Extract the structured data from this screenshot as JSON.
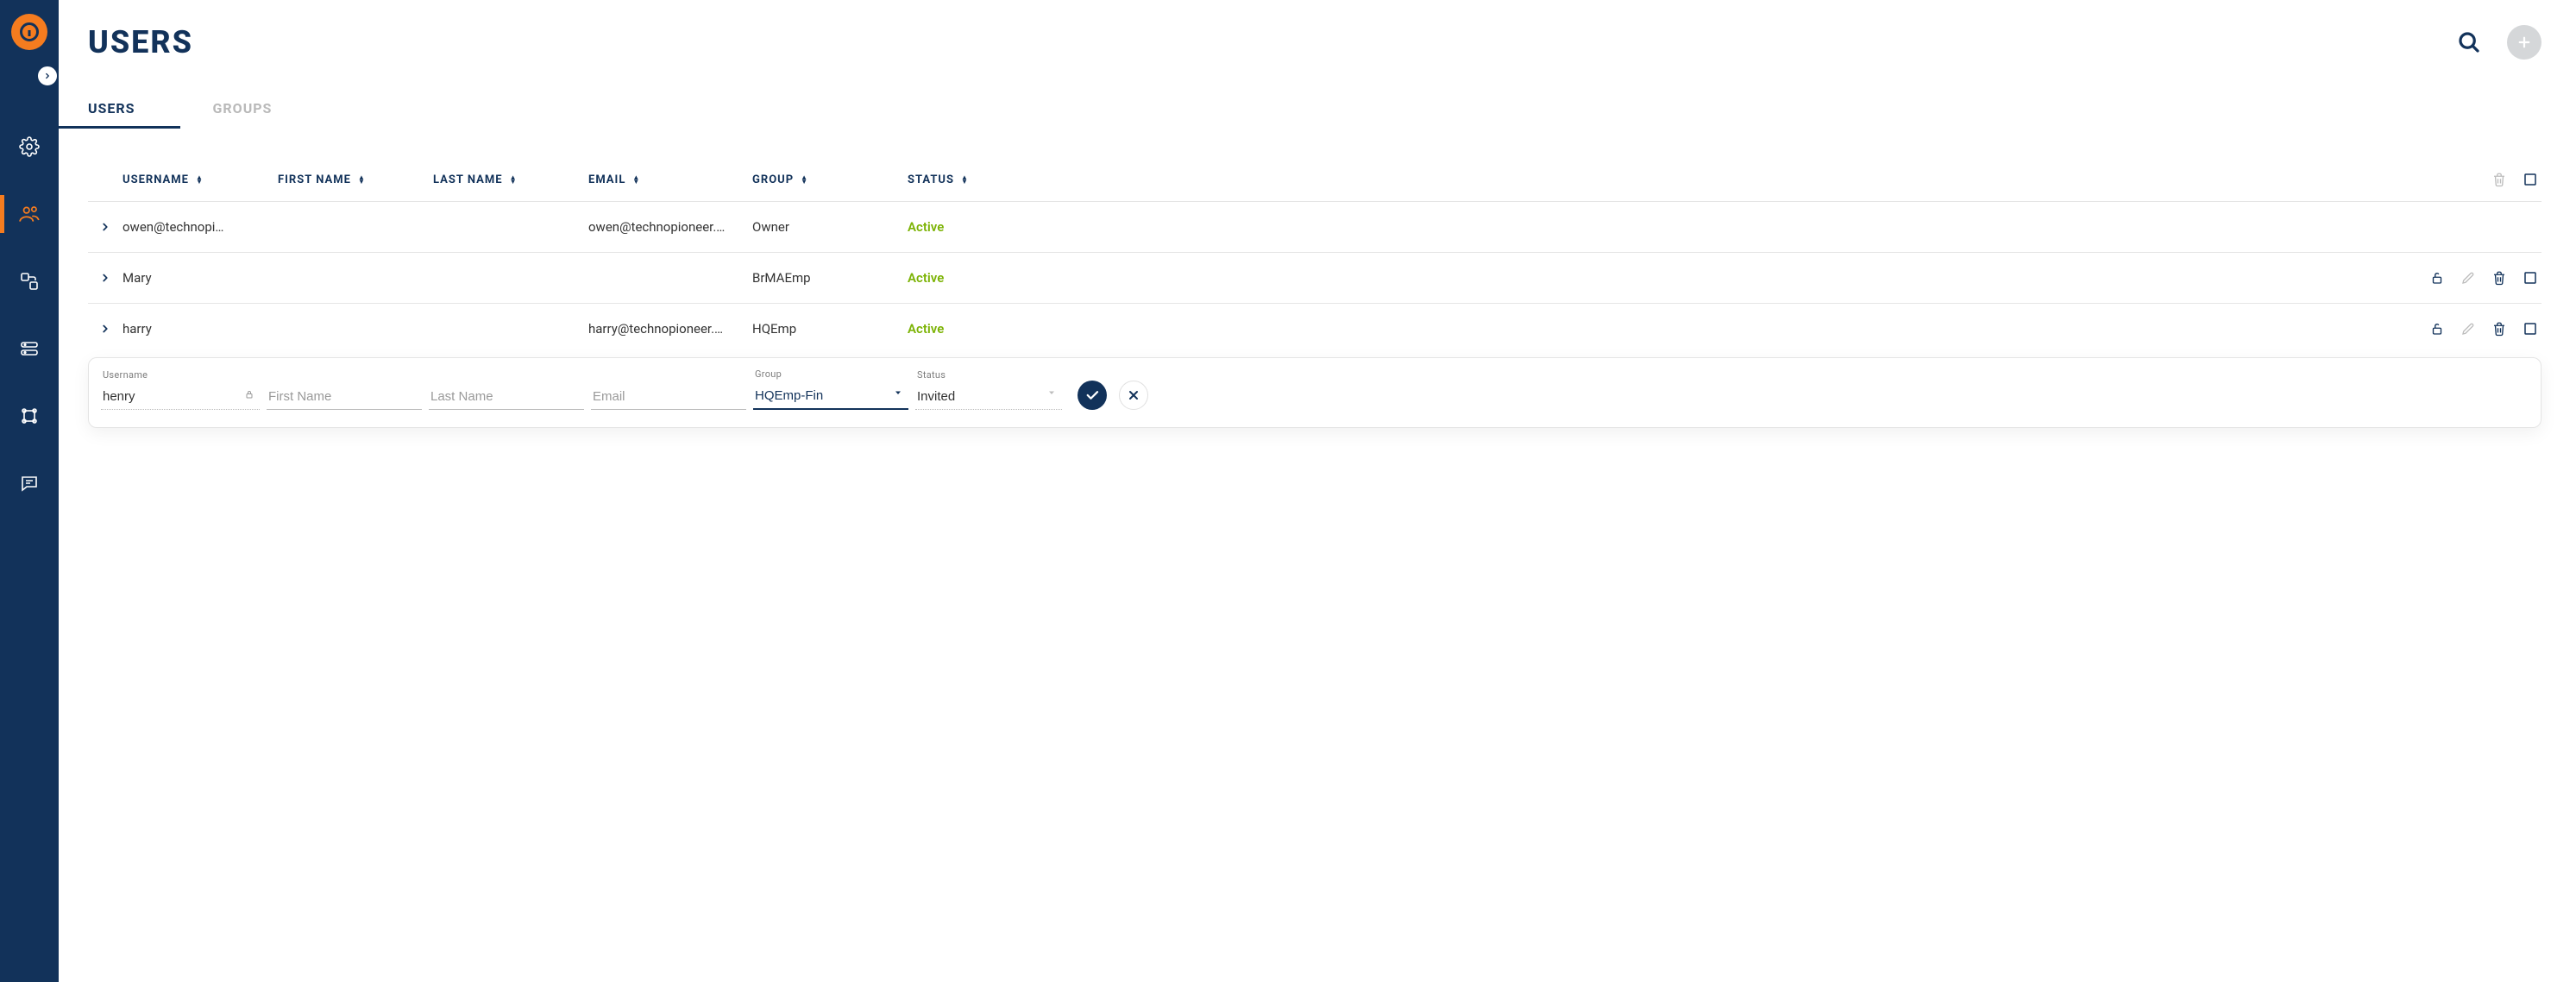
{
  "page": {
    "title": "USERS"
  },
  "sidebar": {
    "items": [
      {
        "name": "settings",
        "icon": "gear-icon"
      },
      {
        "name": "users",
        "icon": "users-icon",
        "active": true
      },
      {
        "name": "network",
        "icon": "network-icon"
      },
      {
        "name": "hosts",
        "icon": "hosts-icon"
      },
      {
        "name": "topology",
        "icon": "topology-icon"
      },
      {
        "name": "logs",
        "icon": "chat-icon"
      }
    ]
  },
  "header": {
    "search_aria": "Search",
    "add_aria": "Add"
  },
  "tabs": [
    {
      "label": "USERS",
      "active": true
    },
    {
      "label": "GROUPS",
      "active": false
    }
  ],
  "columns": {
    "username": "USERNAME",
    "firstname": "FIRST NAME",
    "lastname": "LAST NAME",
    "email": "EMAIL",
    "group": "GROUP",
    "status": "STATUS"
  },
  "rows": [
    {
      "username": "owen@technopi…",
      "firstname": "",
      "lastname": "",
      "email": "owen@technopioneer.…",
      "group": "Owner",
      "status": "Active",
      "actions": {
        "lock": false,
        "edit": false,
        "delete": false,
        "select": false
      }
    },
    {
      "username": "Mary",
      "firstname": "",
      "lastname": "",
      "email": "",
      "group": "BrMAEmp",
      "status": "Active",
      "actions": {
        "lock": true,
        "edit": true,
        "delete": true,
        "select": true
      }
    },
    {
      "username": "harry",
      "firstname": "",
      "lastname": "",
      "email": "harry@technopioneer.…",
      "group": "HQEmp",
      "status": "Active",
      "actions": {
        "lock": true,
        "edit": true,
        "delete": true,
        "select": true
      }
    }
  ],
  "colors": {
    "brand_navy": "#12325a",
    "brand_orange": "#f57c1f",
    "status_active": "#7cb305",
    "muted": "#b9b9b9"
  },
  "new_row": {
    "username_label": "Username",
    "username_value": "henry",
    "firstname_placeholder": "First Name",
    "lastname_placeholder": "Last Name",
    "email_placeholder": "Email",
    "group_label": "Group",
    "group_value": "HQEmp-Fin",
    "status_label": "Status",
    "status_value": "Invited"
  }
}
